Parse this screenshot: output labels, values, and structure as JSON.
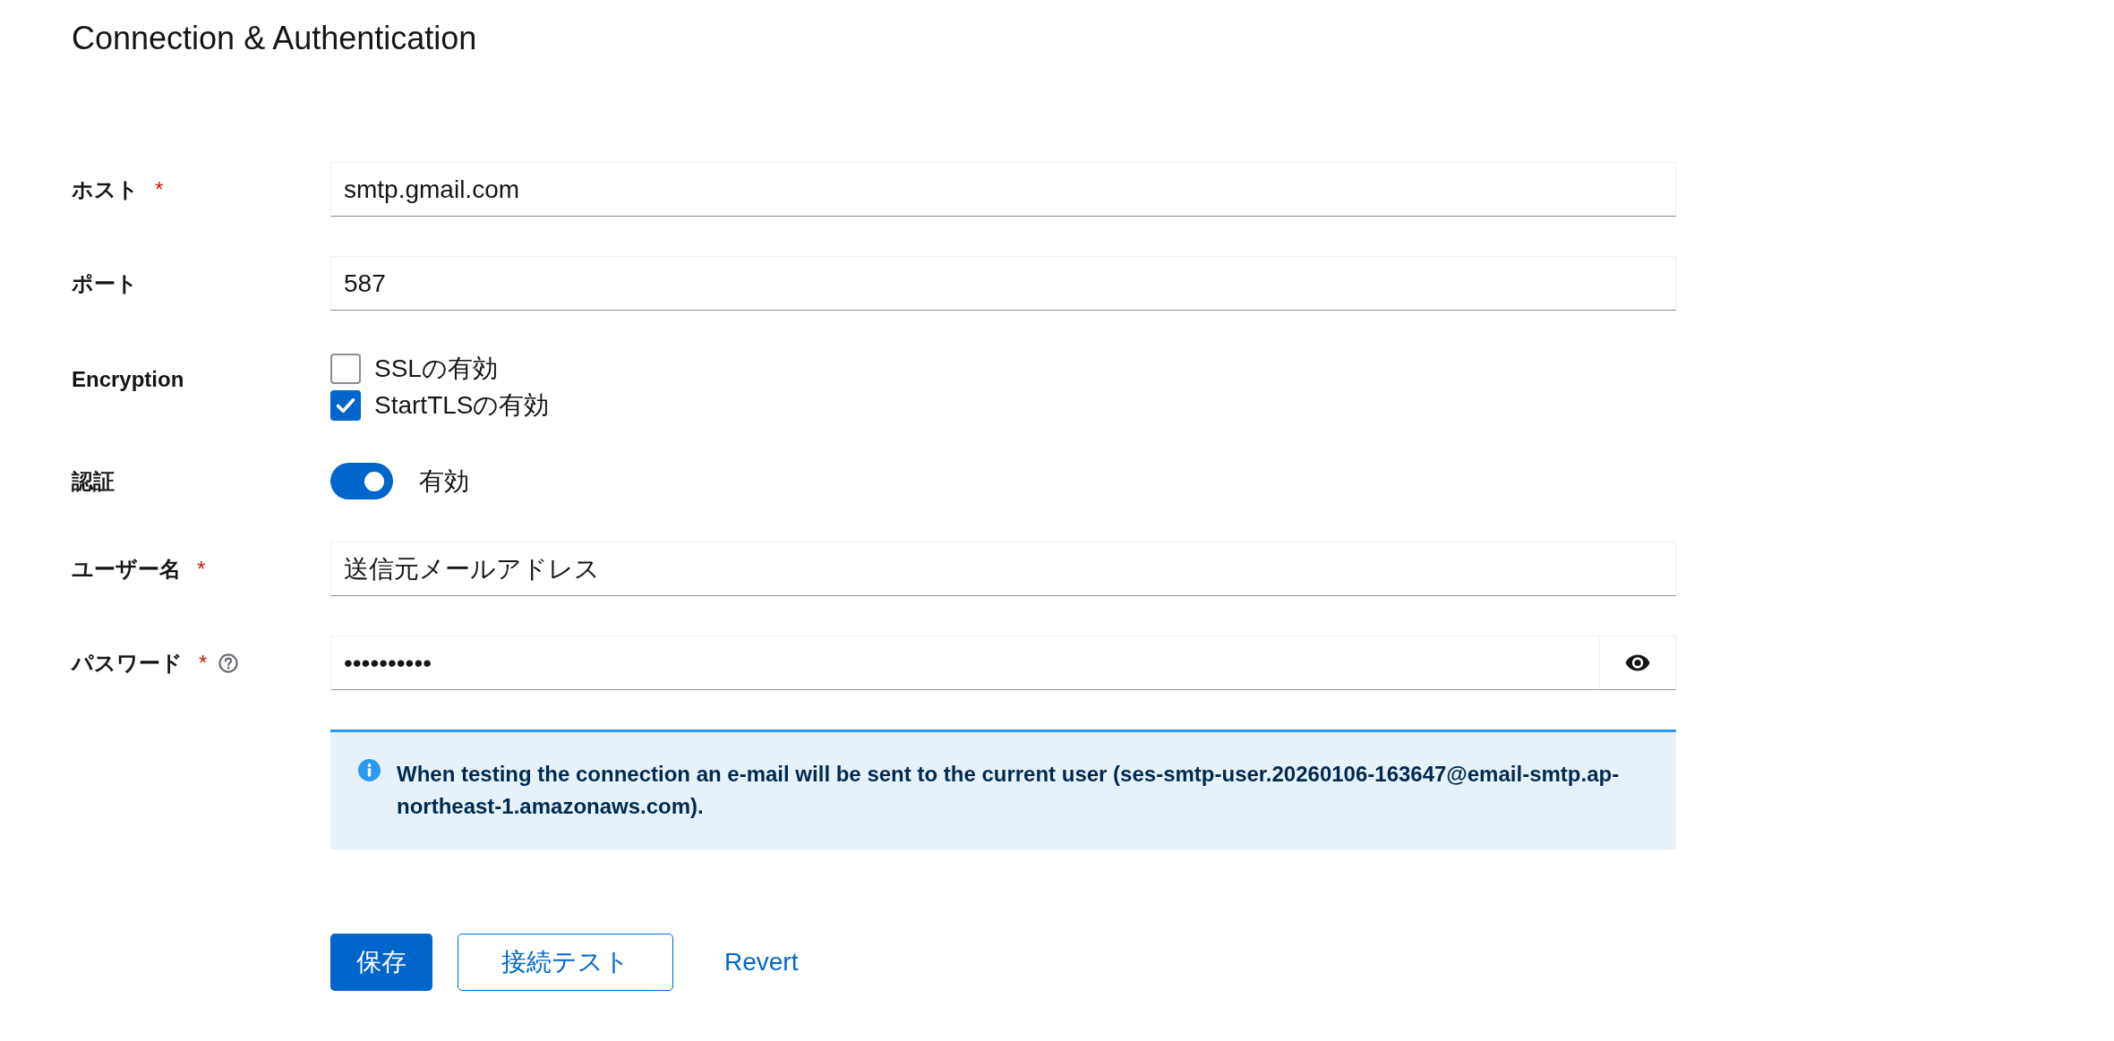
{
  "section": {
    "title": "Connection & Authentication"
  },
  "fields": [
    {
      "kind": "text",
      "label": "ホスト",
      "required_mark": "*",
      "help": false,
      "value": "smtp.gmail.com"
    },
    {
      "kind": "text",
      "label": "ポート",
      "help": false,
      "value": "587"
    },
    {
      "kind": "checkboxes",
      "label": "Encryption",
      "help": false,
      "options": [
        {
          "label": "SSLの有効",
          "checked": false
        },
        {
          "label": "StartTLSの有効",
          "checked": true
        }
      ]
    },
    {
      "kind": "switch",
      "label": "認証",
      "help": false,
      "on": true,
      "text": "有効"
    },
    {
      "kind": "text",
      "label": "ユーザー名",
      "required_mark": "*",
      "help": false,
      "value": "送信元メールアドレス"
    },
    {
      "kind": "password",
      "label": "パスワード",
      "required_mark": "*",
      "help": true,
      "value": "••••••••••"
    }
  ],
  "alert": {
    "kind": "info",
    "text": "When testing the connection an e-mail will be sent to the current user (ses-smtp-user.20260106-163647@email-smtp.ap-northeast-1.amazonaws.com)."
  },
  "buttons": [
    {
      "kind": "primary",
      "label": "保存"
    },
    {
      "kind": "secondary",
      "label": "接続テスト"
    },
    {
      "kind": "link",
      "label": "Revert"
    }
  ]
}
